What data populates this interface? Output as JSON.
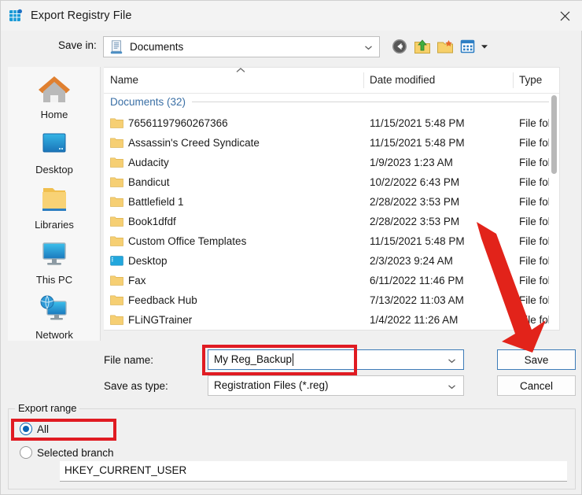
{
  "window": {
    "title": "Export Registry File",
    "icon": "registry-editor-icon",
    "close_label": "✕"
  },
  "savein": {
    "label": "Save in:",
    "value": "Documents",
    "icon": "documents-folder-icon",
    "toolbar": [
      {
        "name": "back-button",
        "label": "Back"
      },
      {
        "name": "up-one-level-button",
        "label": "Up one level"
      },
      {
        "name": "create-new-folder-button",
        "label": "Create New Folder"
      },
      {
        "name": "views-button",
        "label": "Views"
      }
    ]
  },
  "places": [
    {
      "label": "Home",
      "icon": "home-icon"
    },
    {
      "label": "Desktop",
      "icon": "desktop-icon"
    },
    {
      "label": "Libraries",
      "icon": "libraries-folder-icon"
    },
    {
      "label": "This PC",
      "icon": "this-pc-monitor-icon"
    },
    {
      "label": "Network",
      "icon": "network-globe-icon"
    }
  ],
  "filelist": {
    "columns": [
      "Name",
      "Date modified",
      "Type"
    ],
    "group_header": "Documents (32)",
    "rows": [
      {
        "name": "76561197960267366",
        "date": "11/15/2021 5:48 PM",
        "type": "File fold",
        "icon": "folder-icon"
      },
      {
        "name": "Assassin's Creed Syndicate",
        "date": "11/15/2021 5:48 PM",
        "type": "File fold",
        "icon": "folder-icon"
      },
      {
        "name": "Audacity",
        "date": "1/9/2023 1:23 AM",
        "type": "File fold",
        "icon": "folder-icon"
      },
      {
        "name": "Bandicut",
        "date": "10/2/2022 6:43 PM",
        "type": "File fold",
        "icon": "folder-icon"
      },
      {
        "name": "Battlefield 1",
        "date": "2/28/2022 3:53 PM",
        "type": "File fold",
        "icon": "folder-icon"
      },
      {
        "name": "Book1dfdf",
        "date": "2/28/2022 3:53 PM",
        "type": "File fold",
        "icon": "folder-icon"
      },
      {
        "name": "Custom Office Templates",
        "date": "11/15/2021 5:48 PM",
        "type": "File fold",
        "icon": "folder-icon"
      },
      {
        "name": "Desktop",
        "date": "2/3/2023 9:24 AM",
        "type": "File fold",
        "icon": "desktop-folder-icon"
      },
      {
        "name": "Fax",
        "date": "6/11/2022 11:46 PM",
        "type": "File fold",
        "icon": "folder-icon"
      },
      {
        "name": "Feedback Hub",
        "date": "7/13/2022 11:03 AM",
        "type": "File fold",
        "icon": "folder-icon"
      },
      {
        "name": "FLiNGTrainer",
        "date": "1/4/2022 11:26 AM",
        "type": "File fold",
        "icon": "folder-icon"
      }
    ]
  },
  "form": {
    "filename_label": "File name:",
    "filename_value": "My Reg_Backup",
    "savetype_label": "Save as type:",
    "savetype_value": "Registration Files (*.reg)",
    "save_button": "Save",
    "cancel_button": "Cancel"
  },
  "export_range": {
    "legend": "Export range",
    "option_all": "All",
    "option_selected_branch": "Selected branch",
    "selected": "All",
    "branch_value": "HKEY_CURRENT_USER"
  },
  "annotations": {
    "highlight_color": "#e01b22",
    "arrow_color": "#e2231a",
    "accent_color": "#0a64b4",
    "boxes": [
      "filename-field",
      "all-radio-option"
    ],
    "arrow": "points-to-save-button"
  }
}
